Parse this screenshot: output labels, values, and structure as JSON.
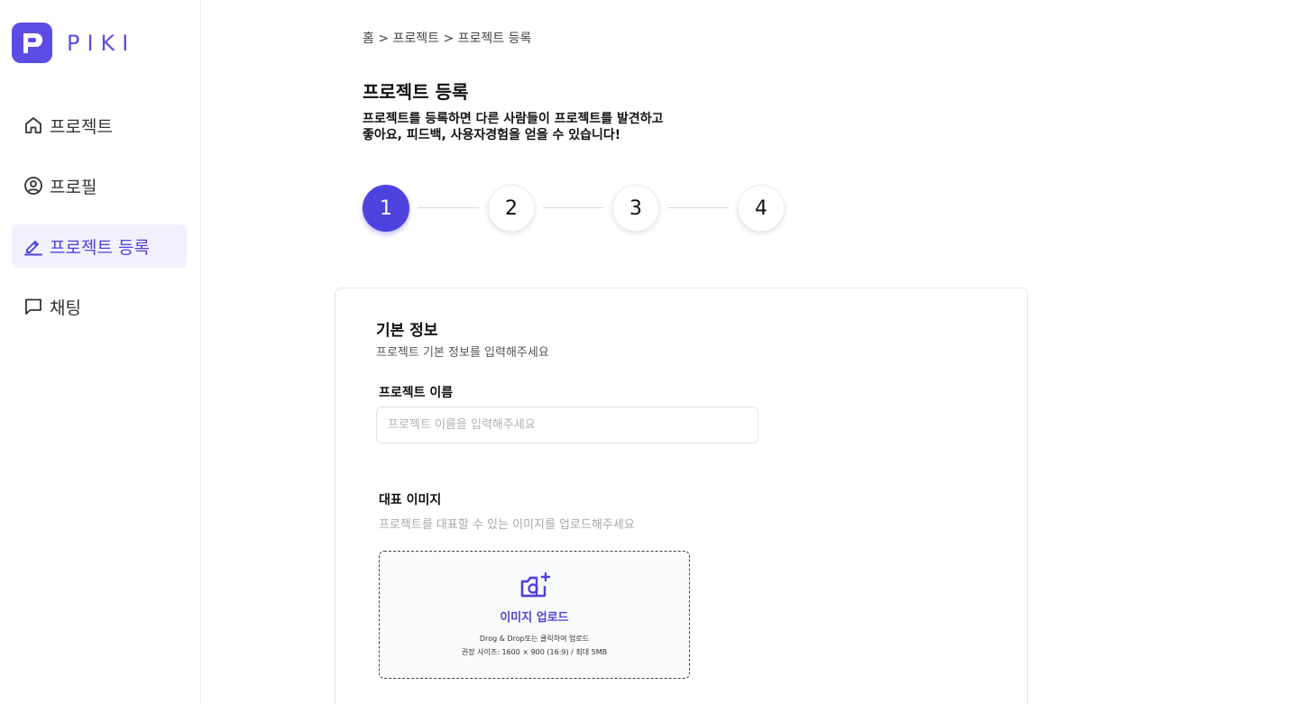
{
  "brand": {
    "name": "PIKI",
    "accent": "#5b4de3"
  },
  "sidebar": {
    "items": [
      {
        "label": "프로젝트",
        "icon": "home-icon",
        "active": false
      },
      {
        "label": "프로필",
        "icon": "user-circle-icon",
        "active": false
      },
      {
        "label": "프로젝트 등록",
        "icon": "edit-icon",
        "active": true
      },
      {
        "label": "채팅",
        "icon": "chat-icon",
        "active": false
      }
    ]
  },
  "breadcrumb": "홈 > 프로젝트 > 프로젝트 등록",
  "page": {
    "title": "프로젝트 등록",
    "description": "프로젝트를 등록하면 다른 사람들이 프로젝트를 발견하고\n좋아요, 피드백, 사용자경험을 얻을 수 있습니다!"
  },
  "stepper": {
    "steps": [
      "1",
      "2",
      "3",
      "4"
    ],
    "current": "1"
  },
  "form": {
    "section_title": "기본 정보",
    "section_subtitle": "프로젝트 기본 정보를 입력해주세요",
    "name": {
      "label": "프로젝트 이름",
      "placeholder": "프로젝트 이름을 입력해주세요",
      "value": ""
    },
    "image": {
      "label": "대표 이미지",
      "help": "프로젝트를 대표할 수 있는 이미지를 업로드해주세요",
      "upload_title": "이미지 업로드",
      "upload_hint_1": "Drog & Drop또는 클릭하여 업로드",
      "upload_hint_2": "권장 사이즈: 1600 × 900 (16:9) / 최대 5MB",
      "icon": "camera-plus-icon"
    }
  }
}
